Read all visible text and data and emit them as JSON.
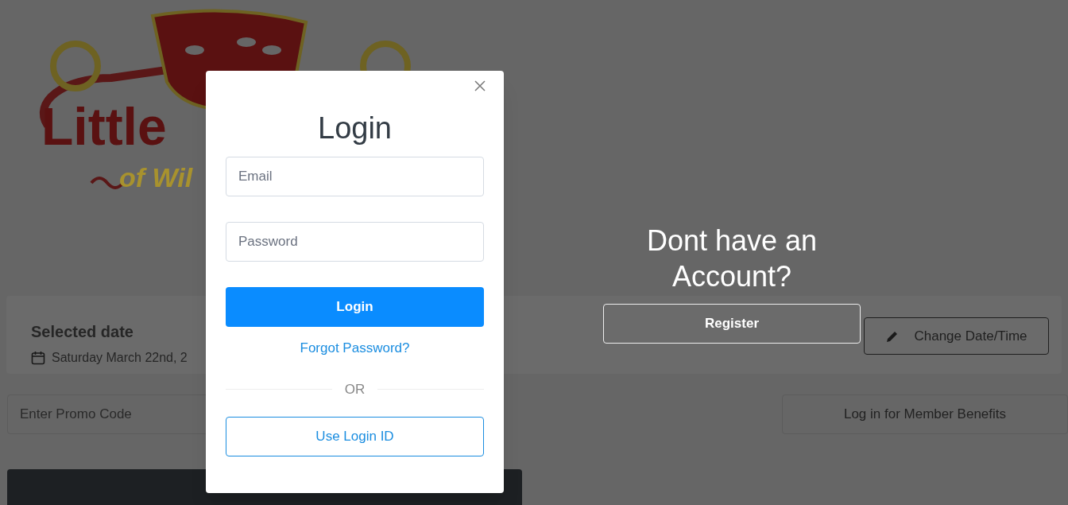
{
  "logo": {
    "line_1": "Little",
    "line_2": "of Wil"
  },
  "selected_date": {
    "title": "Selected date",
    "date": "Saturday March 22nd, 2"
  },
  "change_button": "Change Date/Time",
  "promo": {
    "placeholder": "Enter Promo Code"
  },
  "member_button": "Log in for Member Benefits",
  "register_panel": {
    "heading": "Dont have an Account?",
    "button": "Register"
  },
  "modal": {
    "title": "Login",
    "fields": [
      {
        "placeholder": "Email"
      },
      {
        "placeholder": "Password"
      }
    ],
    "login_button": "Login",
    "forgot_link": "Forgot Password?",
    "divider": "OR",
    "login_id_button": "Use Login ID"
  }
}
